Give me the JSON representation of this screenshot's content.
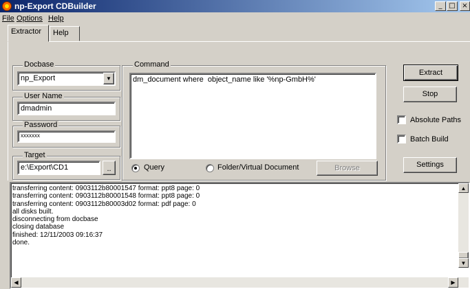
{
  "window": {
    "title": "np-Export CDBuilder",
    "min_label": "_",
    "max_label": "□",
    "close_label": "×"
  },
  "menu": {
    "file": "File",
    "options": "Options",
    "help": "Help"
  },
  "tabs": [
    {
      "label": "Extractor"
    },
    {
      "label": "Help"
    }
  ],
  "docbase": {
    "label": "Docbase",
    "value": "np_Export"
  },
  "user_name": {
    "label": "User Name",
    "value": "dmadmin"
  },
  "password": {
    "label": "Password",
    "value": "xxxxxxx"
  },
  "target": {
    "label": "Target",
    "value": "e:\\Export\\CD1",
    "browse": ".."
  },
  "command": {
    "label": "Command",
    "value": "dm_document where  object_name like '%np-GmbH%'",
    "mode_query": "Query",
    "mode_folder": "Folder/Virtual Document",
    "browse": "Browse",
    "selected_mode": "Query"
  },
  "actions": {
    "extract": "Extract",
    "stop": "Stop",
    "absolute_paths": "Absolute Paths",
    "absolute_paths_checked": false,
    "batch_build": "Batch Build",
    "batch_build_checked": false,
    "settings": "Settings"
  },
  "log": [
    "transferring content: 0903112b80001547 format: ppt8 page: 0",
    "transferring content: 0903112b80001548 format: ppt8 page: 0",
    "transferring content: 0903112b80003d02 format: pdf page: 0",
    "all disks built.",
    "disconnecting from docbase",
    "closing database",
    "finished: 12/11/2003 09:16:37",
    "done."
  ],
  "icons": {
    "app": "app-icon",
    "dropdown": "chevron-down-icon",
    "scroll_up": "arrow-up-icon",
    "scroll_down": "arrow-down-icon",
    "scroll_left": "arrow-left-icon",
    "scroll_right": "arrow-right-icon"
  },
  "colors": {
    "titlebar_start": "#0a246a",
    "titlebar_end": "#a6caf0",
    "face": "#d4d0c8"
  }
}
